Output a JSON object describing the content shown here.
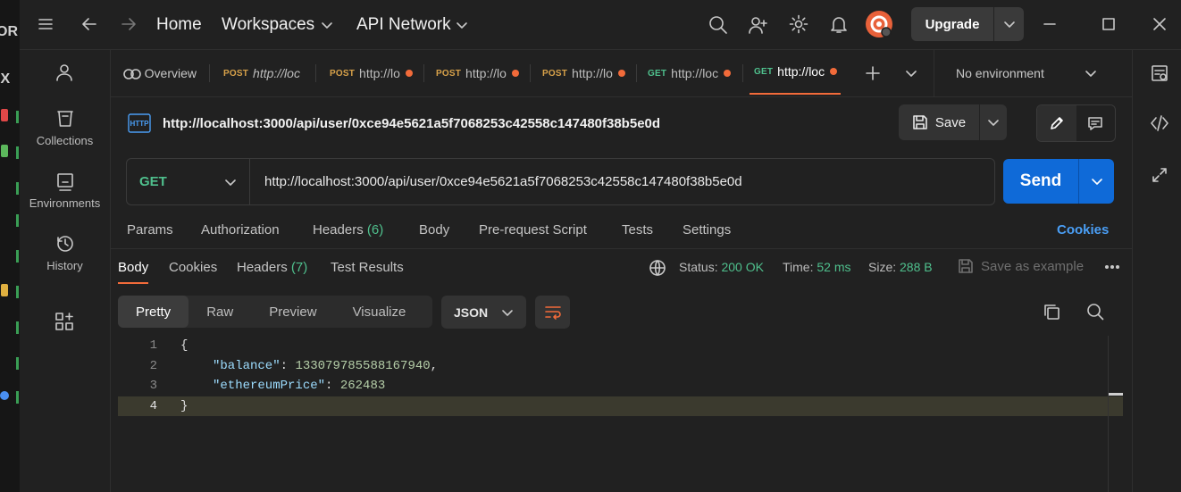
{
  "left_strip": {
    "edge_top": "OR",
    "edge_mid": "IX"
  },
  "topbar": {
    "home": "Home",
    "workspaces": "Workspaces",
    "api_network": "API Network",
    "upgrade": "Upgrade"
  },
  "sidebar": {
    "items": [
      {
        "label": "Collections",
        "icon": "collections-icon"
      },
      {
        "label": "Environments",
        "icon": "environments-icon"
      },
      {
        "label": "History",
        "icon": "history-icon"
      }
    ]
  },
  "tabs": {
    "overview": "Overview",
    "items": [
      {
        "method": "POST",
        "url": "http://loc",
        "unsaved": false
      },
      {
        "method": "POST",
        "url": "http://lo",
        "unsaved": true
      },
      {
        "method": "POST",
        "url": "http://lo",
        "unsaved": true
      },
      {
        "method": "POST",
        "url": "http://lo",
        "unsaved": true
      },
      {
        "method": "GET",
        "url": "http://loc",
        "unsaved": true
      },
      {
        "method": "GET",
        "url": "http://loc",
        "unsaved": true,
        "active": true
      }
    ],
    "environment": "No environment"
  },
  "request": {
    "title": "http://localhost:3000/api/user/0xce94e5621a5f7068253c42558c147480f38b5e0d",
    "save": "Save",
    "method": "GET",
    "url": "http://localhost:3000/api/user/0xce94e5621a5f7068253c42558c147480f38b5e0d",
    "send": "Send",
    "tabs": {
      "params": "Params",
      "authorization": "Authorization",
      "headers": "Headers",
      "headers_count": "(6)",
      "body": "Body",
      "prerequest": "Pre-request Script",
      "tests": "Tests",
      "settings": "Settings",
      "cookies": "Cookies"
    }
  },
  "response": {
    "tabs": {
      "body": "Body",
      "cookies": "Cookies",
      "headers": "Headers",
      "headers_count": "(7)",
      "test_results": "Test Results"
    },
    "status_label": "Status:",
    "status_value": "200 OK",
    "time_label": "Time:",
    "time_value": "52 ms",
    "size_label": "Size:",
    "size_value": "288 B",
    "save_example": "Save as example",
    "views": [
      "Pretty",
      "Raw",
      "Preview",
      "Visualize"
    ],
    "format": "JSON",
    "code": {
      "l1_num": "1",
      "l1": "{",
      "l2_num": "2",
      "l2_key": "\"balance\"",
      "l2_sep": ": ",
      "l2_val": "133079785588167940",
      "l2_end": ",",
      "l3_num": "3",
      "l3_key": "\"ethereumPrice\"",
      "l3_sep": ": ",
      "l3_val": "262483",
      "l4_num": "4",
      "l4": "}"
    }
  }
}
